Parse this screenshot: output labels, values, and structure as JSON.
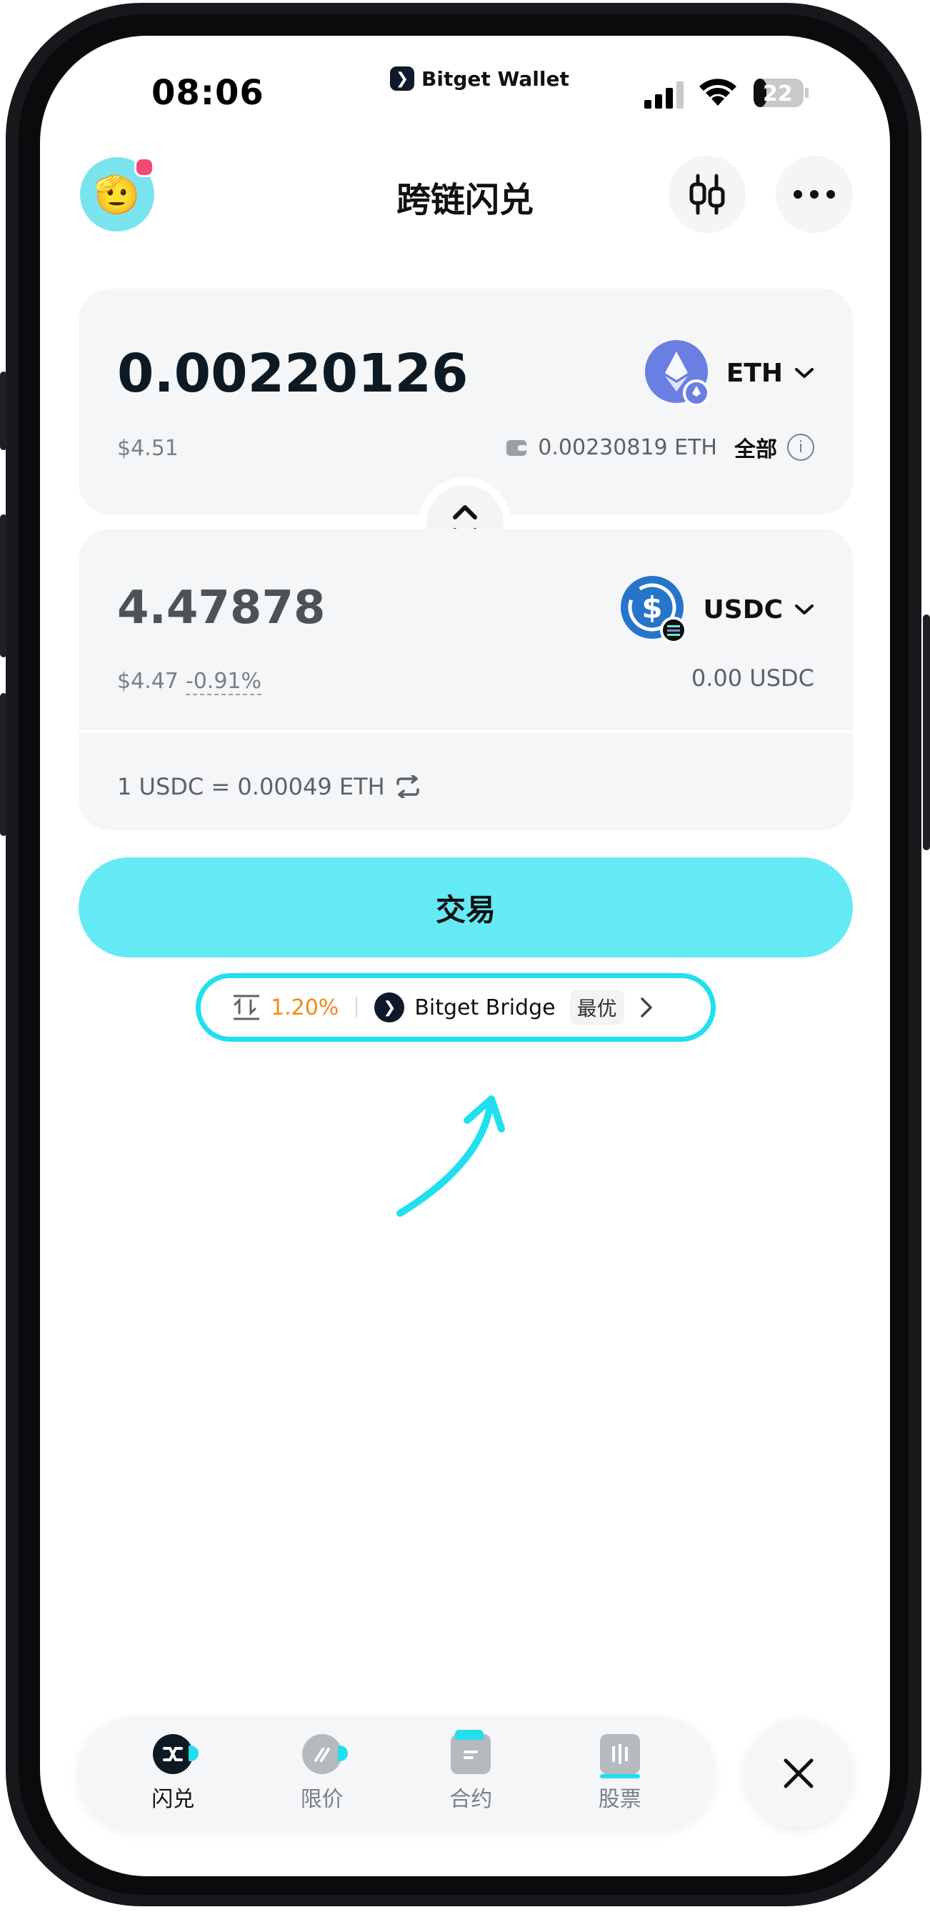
{
  "status_bar": {
    "time": "08:06",
    "carrier_app": "Bitget Wallet",
    "battery": "22"
  },
  "header": {
    "title": "跨链闪兑",
    "chart_icon": "candlestick-icon",
    "more_icon": "more-dots-icon"
  },
  "from": {
    "amount": "0.00220126",
    "usd_value": "$4.51",
    "token": "ETH",
    "balance": "0.00230819 ETH",
    "all_label": "全部",
    "info_glyph": "i"
  },
  "to": {
    "amount": "4.47878",
    "usd_value": "$4.47",
    "price_impact": "-0.91%",
    "token": "USDC",
    "balance": "0.00 USDC"
  },
  "rate": {
    "text": "1 USDC = 0.00049 ETH"
  },
  "trade_button": {
    "label": "交易"
  },
  "route": {
    "slippage": "1.20%",
    "provider": "Bitget Bridge",
    "badge": "最优"
  },
  "tabbar": {
    "tabs": [
      {
        "label": "闪兑",
        "active": true
      },
      {
        "label": "限价",
        "active": false
      },
      {
        "label": "合约",
        "active": false
      },
      {
        "label": "股票",
        "active": false
      }
    ]
  },
  "colors": {
    "accent": "#63eaf5",
    "highlight": "#21dfee",
    "slippage": "#f08a1a",
    "eth": "#6b7fe3",
    "usdc": "#2775ca"
  }
}
